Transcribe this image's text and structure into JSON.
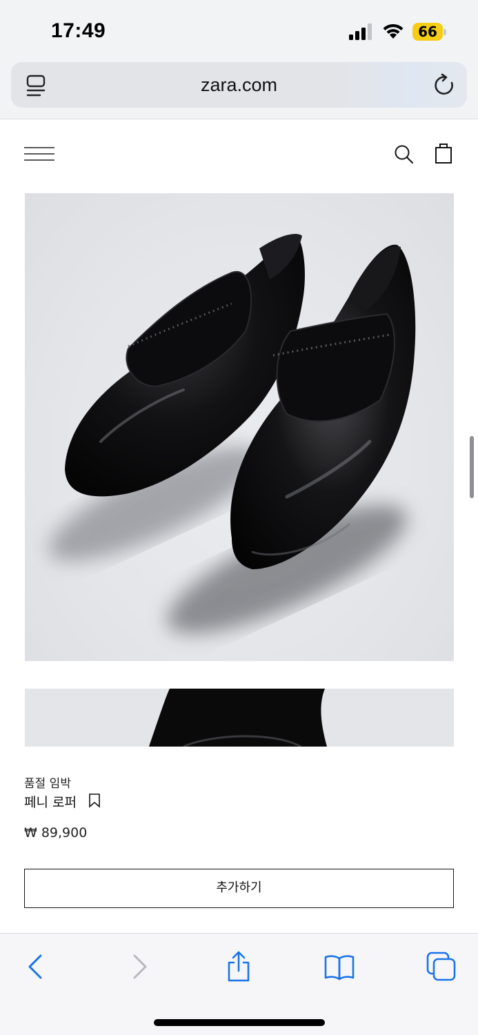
{
  "status_bar": {
    "time": "17:49",
    "battery": "66",
    "battery_color": "#f5cd17"
  },
  "browser": {
    "url": "zara.com"
  },
  "header": {
    "menu_icon": "hamburger-menu-icon",
    "search_icon": "search-icon",
    "bag_icon": "shopping-bag-icon"
  },
  "product": {
    "stock_status": "품절 임박",
    "name": "페니 로퍼",
    "price": "₩ 89,900",
    "add_button_label": "추가하기"
  },
  "toolbar": {
    "back_icon": "chevron-left-icon",
    "forward_icon": "chevron-right-icon",
    "share_icon": "share-icon",
    "bookmarks_icon": "book-icon",
    "tabs_icon": "tabs-icon",
    "accent": "#1a73e8"
  }
}
